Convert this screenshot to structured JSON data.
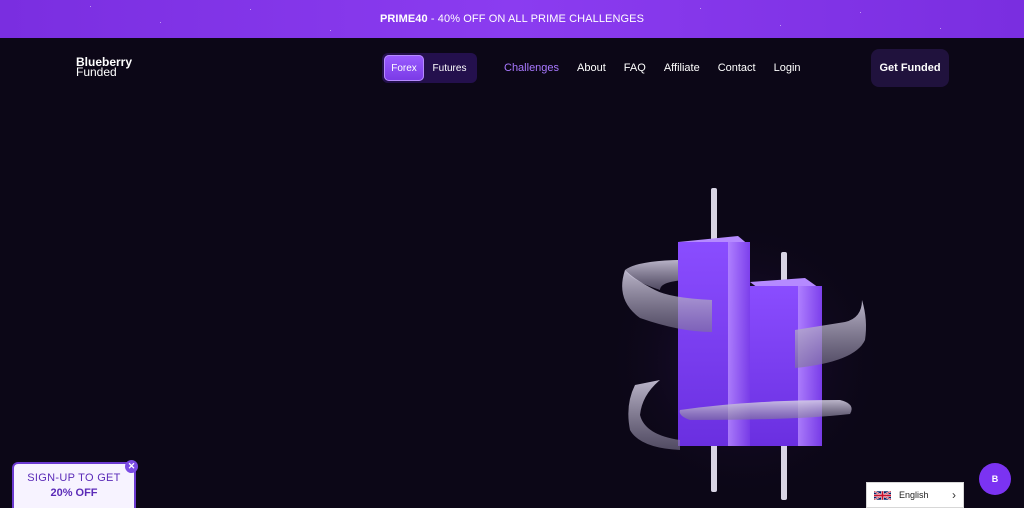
{
  "promo": {
    "code": "PRIME40",
    "text": " - 40% OFF ON ALL PRIME CHALLENGES"
  },
  "brand": {
    "line1": "Blueberry",
    "line2": "Funded"
  },
  "market_toggle": {
    "options": [
      {
        "label": "Forex",
        "active": true
      },
      {
        "label": "Futures",
        "active": false
      }
    ]
  },
  "nav": {
    "links": [
      "Challenges",
      "About",
      "FAQ",
      "Affiliate",
      "Contact",
      "Login"
    ],
    "active_link": "Challenges"
  },
  "cta": {
    "label": "Get Funded"
  },
  "signup_popup": {
    "line1": "SIGN-UP TO GET",
    "line2": "20% OFF",
    "close_icon": "close-icon"
  },
  "language": {
    "label": "English",
    "flag_icon": "uk-flag-icon",
    "chevron_icon": "chevron-right-icon"
  },
  "chat_widget": {
    "label": "B"
  },
  "colors": {
    "background": "#0c0717",
    "accent": "#8b3cf0",
    "active_link": "#a878ff"
  }
}
